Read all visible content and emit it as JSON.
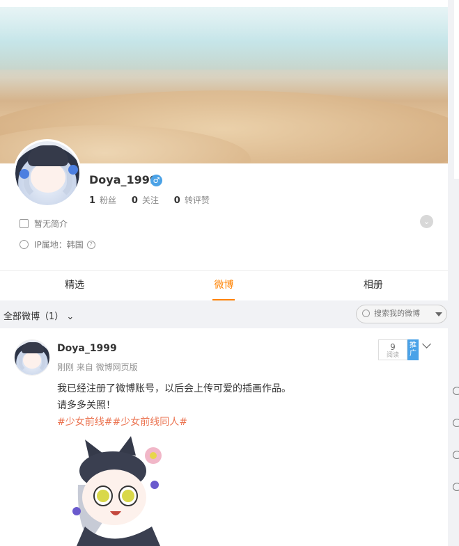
{
  "profile": {
    "name": "Doya_1999",
    "gender": "♂",
    "stats": [
      {
        "count": "1",
        "label": "粉丝"
      },
      {
        "count": "0",
        "label": "关注"
      },
      {
        "count": "0",
        "label": "转评赞"
      }
    ],
    "bio": "暂无简介",
    "ip_location": "IP属地：韩国",
    "ip_help": "?"
  },
  "tabs": [
    {
      "label": "精选",
      "active": false
    },
    {
      "label": "微博",
      "active": true
    },
    {
      "label": "相册",
      "active": false
    }
  ],
  "filter": {
    "label": "全部微博（1）",
    "search_placeholder": "搜索我的微博"
  },
  "post": {
    "author": "Doya_1999",
    "meta": "刚刚  来自  微博网页版",
    "read_count": "9",
    "read_label": "阅读",
    "promote_label": "推广",
    "text_line1": "我已经注册了微博账号，以后会上传可爱的插画作品。",
    "text_line2": "请多多关照！",
    "hashtags": "#少女前线##少女前线同人#"
  },
  "colors": {
    "accent": "#ff8200",
    "hashtag": "#eb7350",
    "verified_blue": "#4ba2e6"
  }
}
